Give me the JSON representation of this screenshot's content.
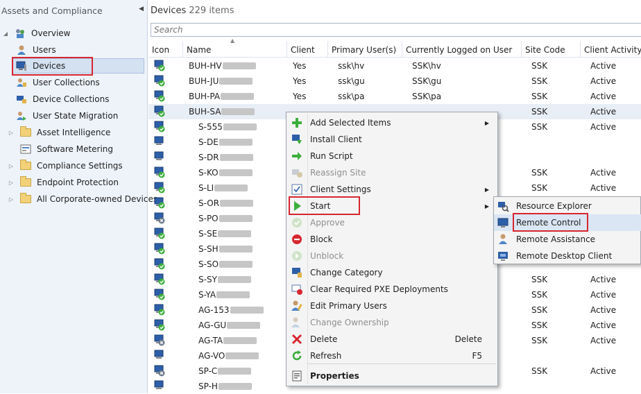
{
  "nav": {
    "title": "Assets and Compliance",
    "items": [
      {
        "label": "Overview"
      },
      {
        "label": "Users"
      },
      {
        "label": "Devices"
      },
      {
        "label": "User Collections"
      },
      {
        "label": "Device Collections"
      },
      {
        "label": "User State Migration"
      },
      {
        "label": "Asset Intelligence"
      },
      {
        "label": "Software Metering"
      },
      {
        "label": "Compliance Settings"
      },
      {
        "label": "Endpoint Protection"
      },
      {
        "label": "All Corporate-owned Devices"
      }
    ]
  },
  "main": {
    "title": "Devices",
    "count": "229 items",
    "search_placeholder": "Search",
    "columns": [
      "Icon",
      "Name",
      "Client",
      "Primary User(s)",
      "Currently Logged on User",
      "Site Code",
      "Client Activity"
    ],
    "rows": [
      {
        "name": "BUH-HV",
        "client": "Yes",
        "primary": "ssk\\hv",
        "logged": "SSK\\hv",
        "site": "SSK",
        "activity": "Active"
      },
      {
        "name": "BUH-JU",
        "client": "Yes",
        "primary": "ssk\\gu",
        "logged": "SSK\\gu",
        "site": "SSK",
        "activity": "Active"
      },
      {
        "name": "BUH-PA",
        "client": "Yes",
        "primary": "ssk\\pa",
        "logged": "SSK\\pa",
        "site": "SSK",
        "activity": "Active"
      },
      {
        "name": "BUH-SA",
        "client": "",
        "primary": "",
        "logged": "",
        "site": "SSK",
        "activity": "Active"
      },
      {
        "name": "S-555",
        "client": "",
        "primary": "",
        "logged": "",
        "site": "SSK",
        "activity": "Active"
      },
      {
        "name": "S-DE",
        "client": "",
        "primary": "",
        "logged": "",
        "site": "",
        "activity": ""
      },
      {
        "name": "S-DR",
        "client": "",
        "primary": "",
        "logged": "",
        "site": "",
        "activity": ""
      },
      {
        "name": "S-KO",
        "client": "",
        "primary": "",
        "logged": "",
        "site": "SSK",
        "activity": "Active"
      },
      {
        "name": "S-LI",
        "client": "",
        "primary": "",
        "logged": "",
        "site": "SSK",
        "activity": "Active"
      },
      {
        "name": "S-OR",
        "client": "",
        "primary": "",
        "logged": "",
        "site": "",
        "activity": ""
      },
      {
        "name": "S-PO",
        "client": "",
        "primary": "",
        "logged": "",
        "site": "",
        "activity": ""
      },
      {
        "name": "S-SE",
        "client": "",
        "primary": "",
        "logged": "",
        "site": "",
        "activity": ""
      },
      {
        "name": "S-SH",
        "client": "",
        "primary": "",
        "logged": "",
        "site": "",
        "activity": ""
      },
      {
        "name": "S-SO",
        "client": "",
        "primary": "",
        "logged": "",
        "site": "",
        "activity": ""
      },
      {
        "name": "S-SY",
        "client": "",
        "primary": "",
        "logged": "",
        "site": "SSK",
        "activity": "Active"
      },
      {
        "name": "S-YA",
        "client": "",
        "primary": "",
        "logged": "",
        "site": "SSK",
        "activity": "Active"
      },
      {
        "name": "AG-153",
        "client": "",
        "primary": "",
        "logged": "",
        "site": "SSK",
        "activity": "Active"
      },
      {
        "name": "AG-GU",
        "client": "",
        "primary": "",
        "logged": "",
        "site": "SSK",
        "activity": "Active"
      },
      {
        "name": "AG-TA",
        "client": "",
        "primary": "",
        "logged": "",
        "site": "SSK",
        "activity": "Active"
      },
      {
        "name": "AG-VO",
        "client": "",
        "primary": "",
        "logged": "",
        "site": "",
        "activity": ""
      },
      {
        "name": "SP-C",
        "client": "",
        "primary": "",
        "logged": "",
        "site": "SSK",
        "activity": "Active"
      },
      {
        "name": "SP-H",
        "client": "",
        "primary": "",
        "logged": "",
        "site": "",
        "activity": ""
      }
    ]
  },
  "context_menu": {
    "items": [
      {
        "label": "Add Selected Items",
        "icon": "plus-icon",
        "submenu": true
      },
      {
        "label": "Install Client",
        "icon": "install-client-icon"
      },
      {
        "label": "Run Script",
        "icon": "run-script-icon"
      },
      {
        "label": "Reassign Site",
        "icon": "reassign-site-icon",
        "disabled": true
      },
      {
        "label": "Client Settings",
        "icon": "client-settings-icon",
        "submenu": true
      },
      {
        "label": "Start",
        "icon": "play-icon",
        "submenu": true
      },
      {
        "label": "Approve",
        "icon": "approve-icon",
        "disabled": true
      },
      {
        "label": "Block",
        "icon": "block-icon"
      },
      {
        "label": "Unblock",
        "icon": "unblock-icon",
        "disabled": true
      },
      {
        "label": "Change Category",
        "icon": "change-category-icon"
      },
      {
        "label": "Clear Required PXE Deployments",
        "icon": "pxe-icon"
      },
      {
        "label": "Edit Primary Users",
        "icon": "edit-users-icon"
      },
      {
        "label": "Change Ownership",
        "icon": "change-ownership-icon",
        "disabled": true
      },
      {
        "label": "Delete",
        "icon": "delete-icon",
        "shortcut": "Delete"
      },
      {
        "label": "Refresh",
        "icon": "refresh-icon",
        "shortcut": "F5"
      },
      {
        "label": "Properties",
        "icon": "properties-icon",
        "bold": true
      }
    ]
  },
  "start_submenu": {
    "items": [
      {
        "label": "Resource Explorer",
        "icon": "resource-explorer-icon"
      },
      {
        "label": "Remote Control",
        "icon": "remote-control-icon"
      },
      {
        "label": "Remote Assistance",
        "icon": "remote-assistance-icon"
      },
      {
        "label": "Remote Desktop Client",
        "icon": "remote-desktop-icon"
      }
    ]
  },
  "colors": {
    "highlight_box": "#d7262f",
    "client_green": "#3cae3c"
  }
}
